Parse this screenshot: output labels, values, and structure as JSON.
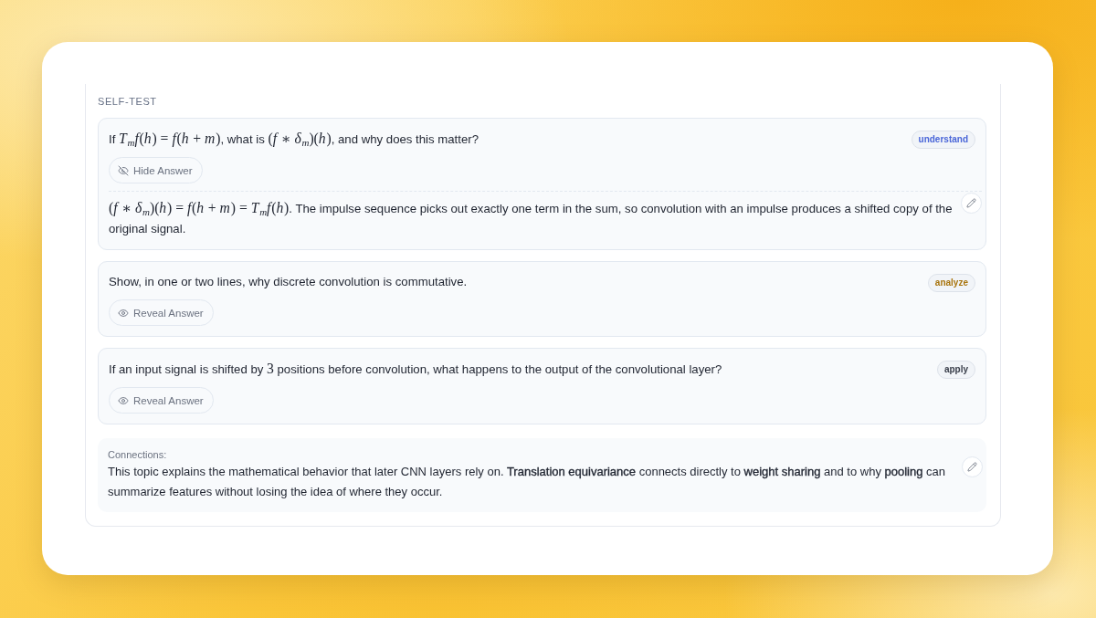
{
  "section_title": "SELF-TEST",
  "questions": [
    {
      "prompt": [
        {
          "kind": "text",
          "text": "If "
        },
        {
          "kind": "math",
          "text": "*T*$_{m}$*f*(*h*) = *f*(*h* + *m*)"
        },
        {
          "kind": "text",
          "text": ", what is "
        },
        {
          "kind": "math",
          "text": "(*f* ∗ *δ*$_{m}$)(*h*)"
        },
        {
          "kind": "text",
          "text": ", and why does this matter?"
        }
      ],
      "tag": {
        "label": "understand",
        "color": "#4a66d8"
      },
      "toggle_label": "Hide Answer",
      "expanded": true,
      "answer": [
        {
          "kind": "math",
          "text": "(*f* ∗ *δ*$_{m}$)(*h*) = *f*(*h* + *m*) = *T*$_{m}$*f*(*h*)"
        },
        {
          "kind": "text",
          "text": ". The impulse sequence picks out exactly one term in the sum, so convolution with an impulse produces a shifted copy of the original signal."
        }
      ]
    },
    {
      "prompt": [
        {
          "kind": "text",
          "text": "Show, in one or two lines, why discrete convolution is commutative."
        }
      ],
      "tag": {
        "label": "analyze",
        "color": "#a8740d"
      },
      "toggle_label": "Reveal Answer",
      "expanded": false
    },
    {
      "prompt": [
        {
          "kind": "text",
          "text": "If an input signal is shifted by "
        },
        {
          "kind": "math",
          "text": "3"
        },
        {
          "kind": "text",
          "text": " positions before convolution, what happens to the output of the convolutional layer?"
        }
      ],
      "tag": {
        "label": "apply",
        "color": "#3b404c"
      },
      "toggle_label": "Reveal Answer",
      "expanded": false
    }
  ],
  "connections": {
    "label": "Connections:",
    "text": "This topic explains the mathematical behavior that later CNN layers rely on. **Translation equivariance** connects directly to **weight sharing** and to why **pooling** can summarize features without losing the idea of where they occur."
  }
}
